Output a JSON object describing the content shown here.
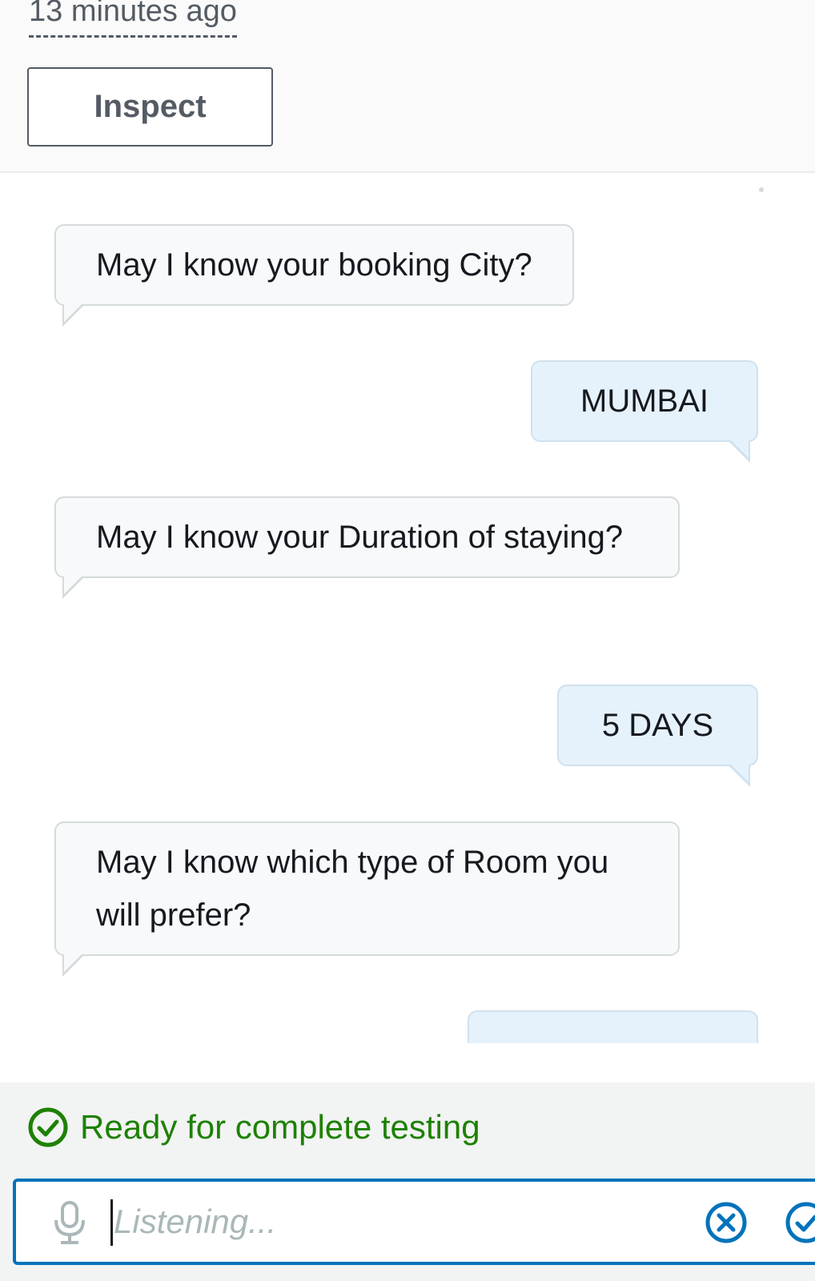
{
  "header": {
    "timestamp": "13 minutes ago",
    "inspect_label": "Inspect"
  },
  "conversation": [
    {
      "role": "bot",
      "text": "May I know your booking City?"
    },
    {
      "role": "user",
      "text": "MUMBAI"
    },
    {
      "role": "bot",
      "text": "May I know your Duration of staying?"
    },
    {
      "role": "user",
      "text": "5 DAYS"
    },
    {
      "role": "bot",
      "text": "May I know which type of Room you will prefer?"
    }
  ],
  "status": {
    "text": "Ready for complete testing",
    "color": "#1d8102"
  },
  "input": {
    "placeholder": "Listening...",
    "value": ""
  },
  "icons": {
    "status": "check-circle-icon",
    "mic": "microphone-icon",
    "clear": "clear-x-circle-icon",
    "submit": "check-submit-icon"
  },
  "colors": {
    "accent": "#0073bb",
    "bot_bubble": "#f7f9fb",
    "user_bubble": "#e6f2fb",
    "success": "#1d8102"
  }
}
